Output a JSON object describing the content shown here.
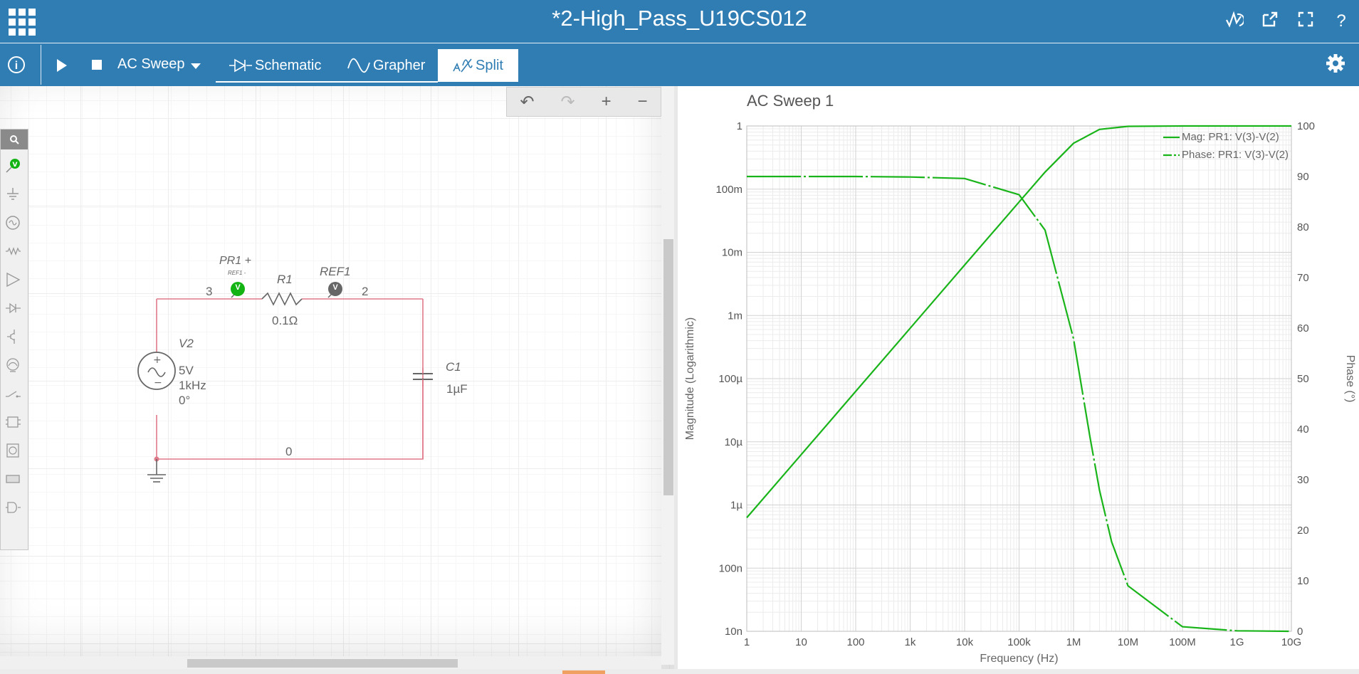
{
  "title_bar": {
    "title": "*2-High_Pass_U19CS012",
    "icons": [
      "apps-grid-icon",
      "trace-icon",
      "popout-icon",
      "fullscreen-icon",
      "help-icon"
    ],
    "help_label": "?"
  },
  "toolbar": {
    "info_label": "i",
    "analysis_label": "AC Sweep",
    "tabs": [
      {
        "label": "Schematic",
        "icon": "schematic-icon"
      },
      {
        "label": "Grapher",
        "icon": "sine-icon"
      },
      {
        "label": "Split",
        "icon": "split-icon"
      }
    ],
    "active_tab": "Split"
  },
  "schematic": {
    "controls": [
      "undo",
      "redo",
      "zoom-in",
      "zoom-out"
    ],
    "probe_label": "PR1",
    "probe_plus": "+",
    "probe_ref_sub": "REF1 -",
    "ref_label": "REF1",
    "probe_v": "V",
    "node3": "3",
    "node2": "2",
    "node0": "0",
    "resistor": {
      "name": "R1",
      "value": "0.1Ω"
    },
    "source": {
      "name": "V2",
      "amp": "5V",
      "freq": "1kHz",
      "phase": "0°"
    },
    "capacitor": {
      "name": "C1",
      "value": "1µF"
    },
    "palette_icons": [
      "search-icon",
      "probe-icon",
      "ground-icon",
      "source-icon",
      "resistor-icon",
      "opamp-icon",
      "diode-icon",
      "transistor-icon",
      "lamp-icon",
      "switch-icon",
      "ic-icon",
      "meter-icon",
      "display-icon",
      "gate-icon"
    ]
  },
  "chart_data": {
    "type": "line",
    "title": "AC Sweep 1",
    "xlabel": "Frequency (Hz)",
    "ylabel": "Magnitude (Logarithmic)",
    "y2label": "Phase (°)",
    "x_scale": "log",
    "xlim": [
      1,
      10000000000
    ],
    "ylim": [
      1e-08,
      1
    ],
    "y2lim": [
      0,
      100
    ],
    "x_ticks": [
      "1",
      "10",
      "100",
      "1k",
      "10k",
      "100k",
      "1M",
      "10M",
      "100M",
      "1G",
      "10G"
    ],
    "y_ticks": [
      "1",
      "100m",
      "10m",
      "1m",
      "100µ",
      "10µ",
      "1µ",
      "100n",
      "10n"
    ],
    "y2_ticks": [
      "100",
      "90",
      "80",
      "70",
      "60",
      "50",
      "40",
      "30",
      "20",
      "10",
      "0"
    ],
    "legend_position": "top-right",
    "grid": true,
    "line_color": "#19b419",
    "series": [
      {
        "name": "Mag: PR1: V(3)-V(2)",
        "axis": "left",
        "x": [
          1,
          10,
          100,
          1000,
          10000,
          100000,
          300000,
          1000000,
          3000000,
          10000000,
          100000000,
          10000000000
        ],
        "y": [
          6.28e-07,
          6.28e-06,
          6.28e-05,
          0.000628,
          0.00628,
          0.0626,
          0.186,
          0.532,
          0.883,
          0.988,
          1,
          1
        ]
      },
      {
        "name": "Phase: PR1: V(3)-V(2)",
        "axis": "right",
        "style": "dash-dot",
        "x": [
          1,
          10,
          100,
          1000,
          10000,
          100000,
          300000,
          1000000,
          2000000,
          3000000,
          5000000,
          10000000,
          100000000,
          1000000000,
          10000000000
        ],
        "y": [
          90,
          90,
          90,
          89.9,
          89.6,
          86.4,
          79.4,
          57.9,
          38.5,
          27.9,
          17.7,
          9.0,
          0.9,
          0.1,
          0
        ]
      }
    ]
  }
}
